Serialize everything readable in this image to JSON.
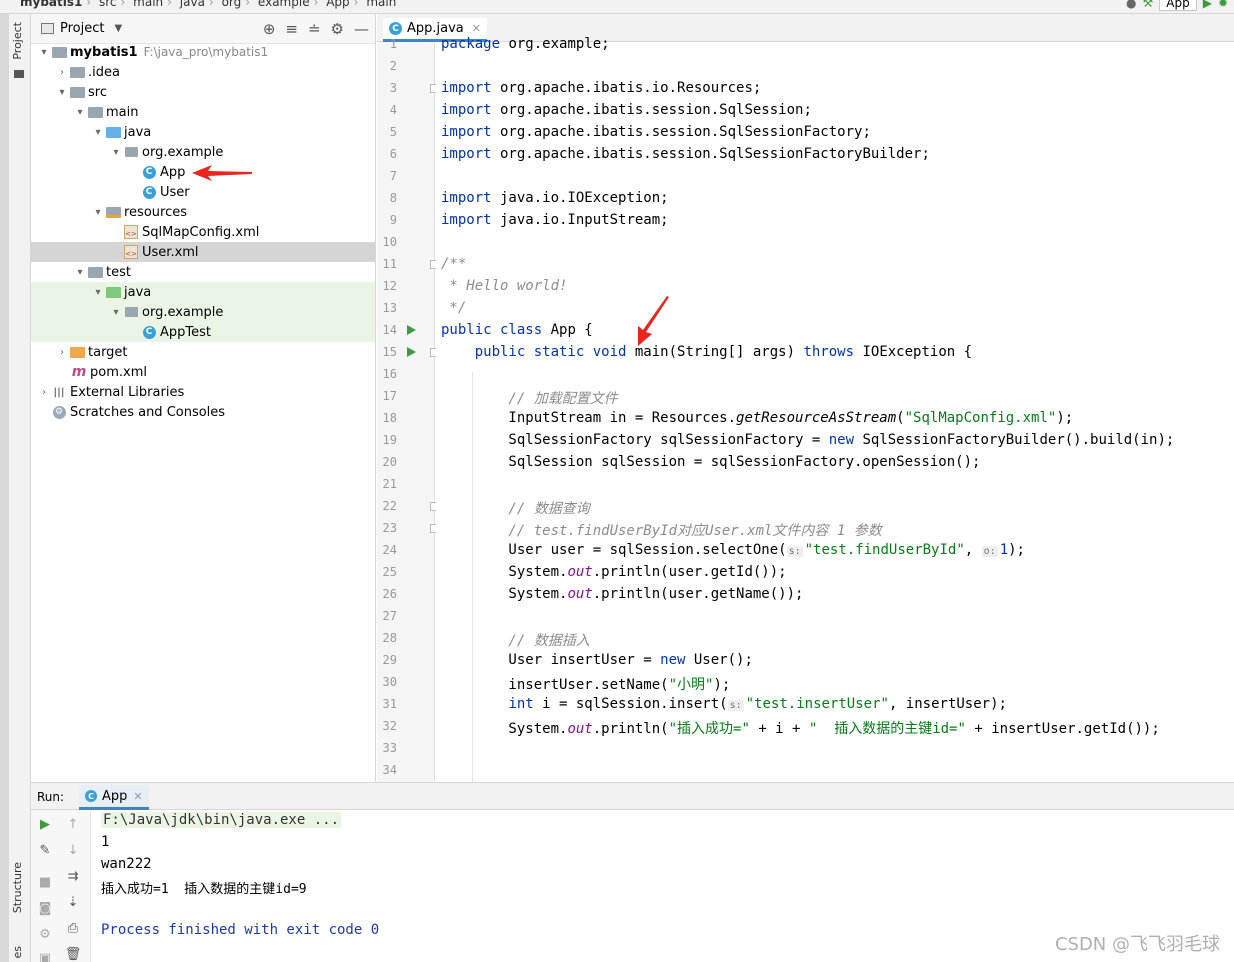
{
  "breadcrumb": [
    "mybatis1",
    "src",
    "main",
    "java",
    "org",
    "example",
    "App",
    "main"
  ],
  "toolbar": {
    "run_config": "App"
  },
  "side_tabs": {
    "project": "Project",
    "structure": "Structure",
    "bottom": "es"
  },
  "project_panel": {
    "title": "Project",
    "tree": [
      {
        "label": "mybatis1",
        "hint": "F:\\java_pro\\mybatis1",
        "icon": "module-folder-icon"
      },
      {
        "label": ".idea",
        "icon": "folder-icon"
      },
      {
        "label": "src",
        "icon": "folder-icon"
      },
      {
        "label": "main",
        "icon": "folder-icon"
      },
      {
        "label": "java",
        "icon": "source-folder-icon"
      },
      {
        "label": "org.example",
        "icon": "package-icon"
      },
      {
        "label": "App",
        "icon": "class-icon"
      },
      {
        "label": "User",
        "icon": "class-icon"
      },
      {
        "label": "resources",
        "icon": "resources-folder-icon"
      },
      {
        "label": "SqlMapConfig.xml",
        "icon": "xml-file-icon"
      },
      {
        "label": "User.xml",
        "icon": "xml-file-icon"
      },
      {
        "label": "test",
        "icon": "folder-icon"
      },
      {
        "label": "java",
        "icon": "test-source-folder-icon"
      },
      {
        "label": "org.example",
        "icon": "package-icon"
      },
      {
        "label": "AppTest",
        "icon": "class-icon"
      },
      {
        "label": "target",
        "icon": "excluded-folder-icon"
      },
      {
        "label": "pom.xml",
        "icon": "maven-icon"
      },
      {
        "label": "External Libraries",
        "icon": "libraries-icon"
      },
      {
        "label": "Scratches and Consoles",
        "icon": "scratches-icon"
      }
    ]
  },
  "editor": {
    "tab": "App.java",
    "line_numbers": [
      "1",
      "2",
      "3",
      "4",
      "5",
      "6",
      "7",
      "8",
      "9",
      "10",
      "11",
      "12",
      "13",
      "14",
      "15",
      "16",
      "17",
      "18",
      "19",
      "20",
      "21",
      "22",
      "23",
      "24",
      "25",
      "26",
      "27",
      "28",
      "29",
      "30",
      "31",
      "32",
      "33",
      "34"
    ],
    "code": {
      "l1a": "package",
      "l1b": " org.example;",
      "imp": "import",
      "l3": " org.apache.ibatis.io.Resources;",
      "l4": " org.apache.ibatis.session.SqlSession;",
      "l5": " org.apache.ibatis.session.SqlSessionFactory;",
      "l6": " org.apache.ibatis.session.SqlSessionFactoryBuilder;",
      "l8": " java.io.IOException;",
      "l9": " java.io.InputStream;",
      "l11": "/**",
      "l12": " * Hello world!",
      "l13": " */",
      "l14a": "public class",
      "l14b": " App {",
      "l15a": "    public static void",
      "l15b": " main(String[] args) ",
      "l15c": "throws",
      "l15d": " IOException {",
      "l17": "        // 加载配置文件",
      "l18a": "        InputStream in = Resources.",
      "l18b": "getResourceAsStream",
      "l18c": "(",
      "l18d": "\"SqlMapConfig.xml\"",
      "l18e": ");",
      "l19a": "        SqlSessionFactory sqlSessionFactory = ",
      "l19b": "new",
      "l19c": " SqlSessionFactoryBuilder().build(in);",
      "l20": "        SqlSession sqlSession = sqlSessionFactory.openSession();",
      "l22": "        // 数据查询",
      "l23": "        // test.findUserById对应User.xml文件内容 1 参数",
      "l24a": "        User user = sqlSession.selectOne(",
      "l24h1": "s:",
      "l24b": "\"test.findUserById\"",
      "l24c": ", ",
      "l24h2": "o:",
      "l24d": "1",
      "l24e": ");",
      "l25a": "        System.",
      "l25b": "out",
      "l25c": ".println(user.getId());",
      "l26a": "        System.",
      "l26b": "out",
      "l26c": ".println(user.getName());",
      "l28": "        // 数据插入",
      "l29a": "        User insertUser = ",
      "l29b": "new",
      "l29c": " User();",
      "l30a": "        insertUser.setName(",
      "l30b": "\"小明\"",
      "l30c": ");",
      "l31a": "        ",
      "l31b": "int",
      "l31c": " i = sqlSession.insert(",
      "l31h": "s:",
      "l31d": "\"test.insertUser\"",
      "l31e": ", insertUser);",
      "l32a": "        System.",
      "l32b": "out",
      "l32c": ".println(",
      "l32d": "\"插入成功=\"",
      "l32e": " + i + ",
      "l32f": "\"  插入数据的主键id=\"",
      "l32g": " + insertUser.getId());"
    }
  },
  "run_panel": {
    "label": "Run:",
    "tab": "App",
    "output": [
      "F:\\Java\\jdk\\bin\\java.exe ...",
      "1",
      "wan222",
      "插入成功=1  插入数据的主键id=9",
      "",
      "Process finished with exit code 0"
    ]
  },
  "watermark": "CSDN @飞飞羽毛球"
}
